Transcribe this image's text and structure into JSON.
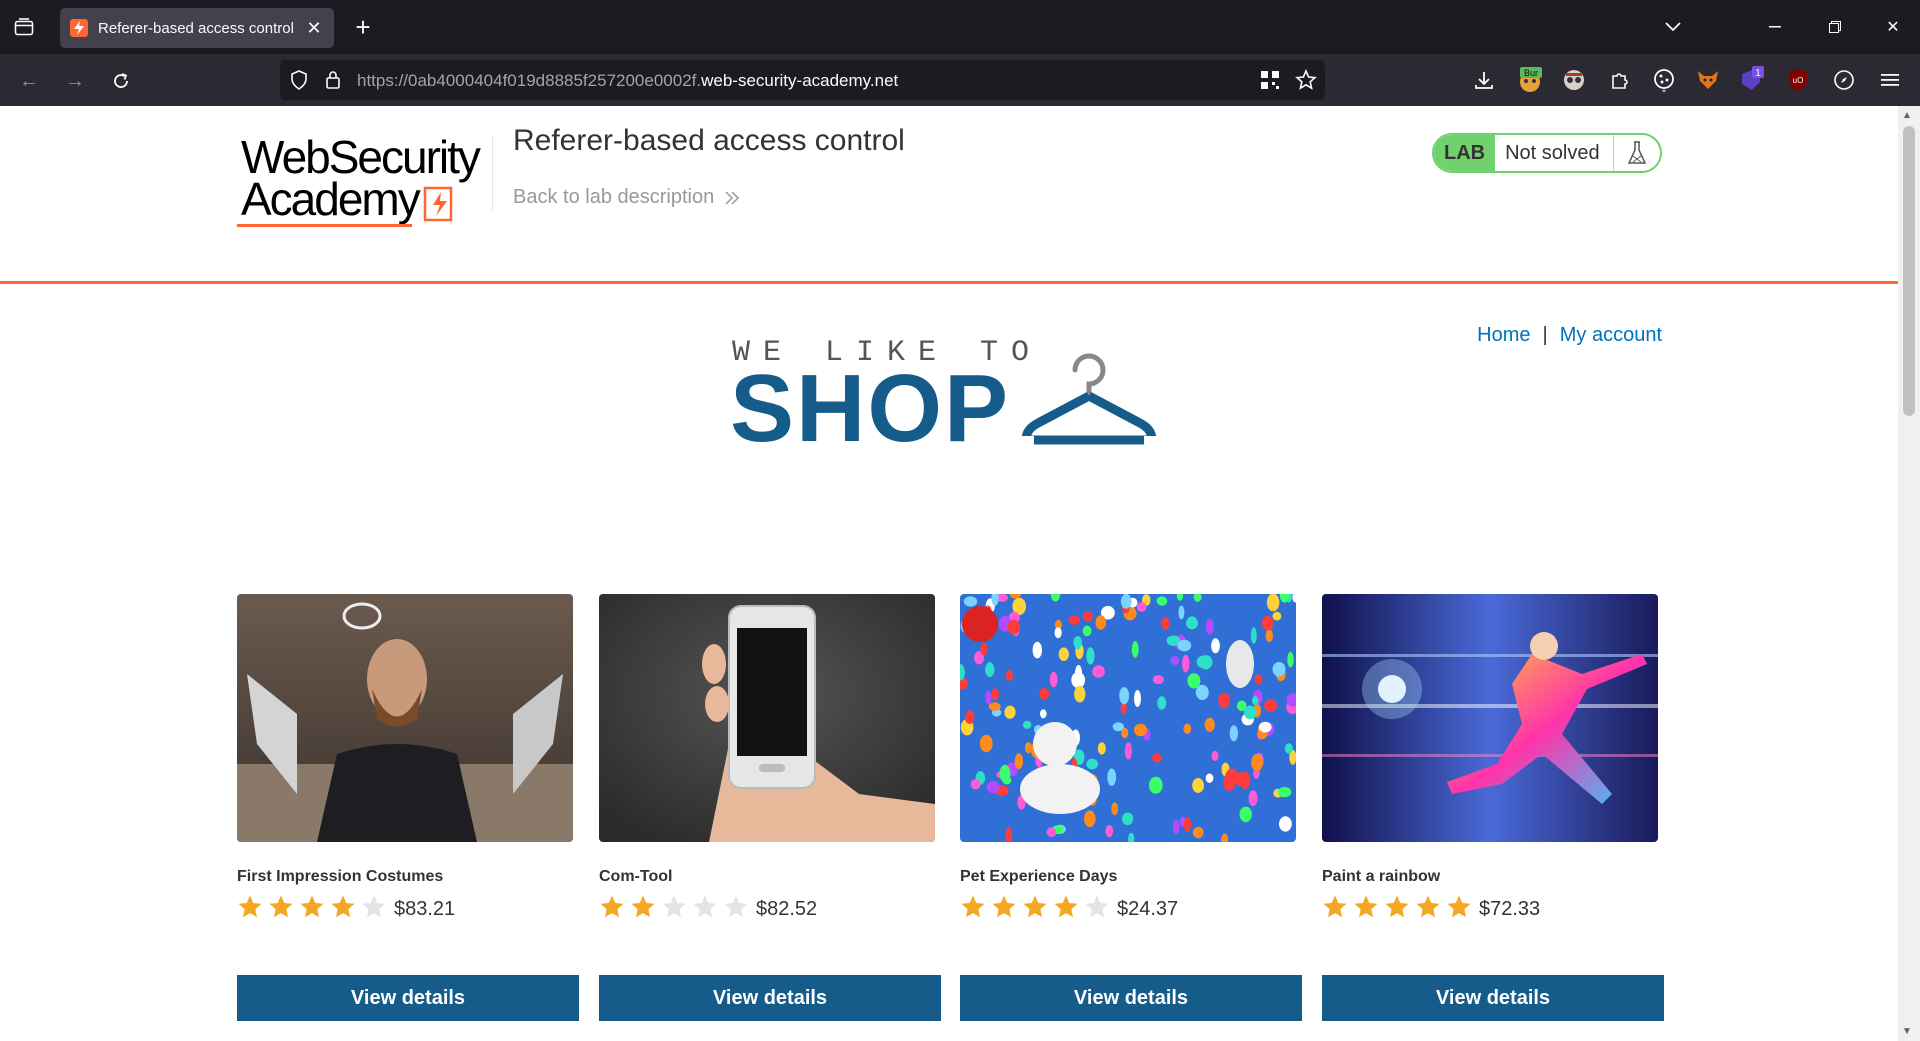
{
  "browser": {
    "tab": {
      "title": "Referer-based access control",
      "favicon": "portswigger-lightning-icon"
    },
    "url": {
      "prefix": "https://0ab4000404f019d8885f257200e0002f.",
      "domain": "web-security-academy.net"
    },
    "extensions": [
      "download-icon",
      "burp-extension-icon",
      "incognito-extension-icon",
      "extensions-puzzle-icon",
      "cookie-extension-icon",
      "fox-extension-icon",
      "shield-extension-icon",
      "ublock-extension-icon",
      "compass-extension-icon"
    ],
    "extension_badge": "1",
    "burp_badge": "Bur"
  },
  "header": {
    "logo_line1": "WebSecurity",
    "logo_line2": "Academy",
    "lab_title": "Referer-based access control",
    "back_link": "Back to lab description",
    "lab_badge": "LAB",
    "lab_status": "Not solved"
  },
  "nav": {
    "home": "Home",
    "separator": "|",
    "my_account": "My account"
  },
  "banner": {
    "top": "WE LIKE TO",
    "shop": "SHOP"
  },
  "colors": {
    "accent": "#ff6633",
    "primary": "#165c8a",
    "link": "#0071bc",
    "lab_green": "#70d16d",
    "star": "#f5a623"
  },
  "products": [
    {
      "name": "First Impression Costumes",
      "rating": 4,
      "price": "$83.21",
      "button": "View details"
    },
    {
      "name": "Com-Tool",
      "rating": 2,
      "price": "$82.52",
      "button": "View details"
    },
    {
      "name": "Pet Experience Days",
      "rating": 4,
      "price": "$24.37",
      "button": "View details"
    },
    {
      "name": "Paint a rainbow",
      "rating": 5,
      "price": "$72.33",
      "button": "View details"
    }
  ]
}
